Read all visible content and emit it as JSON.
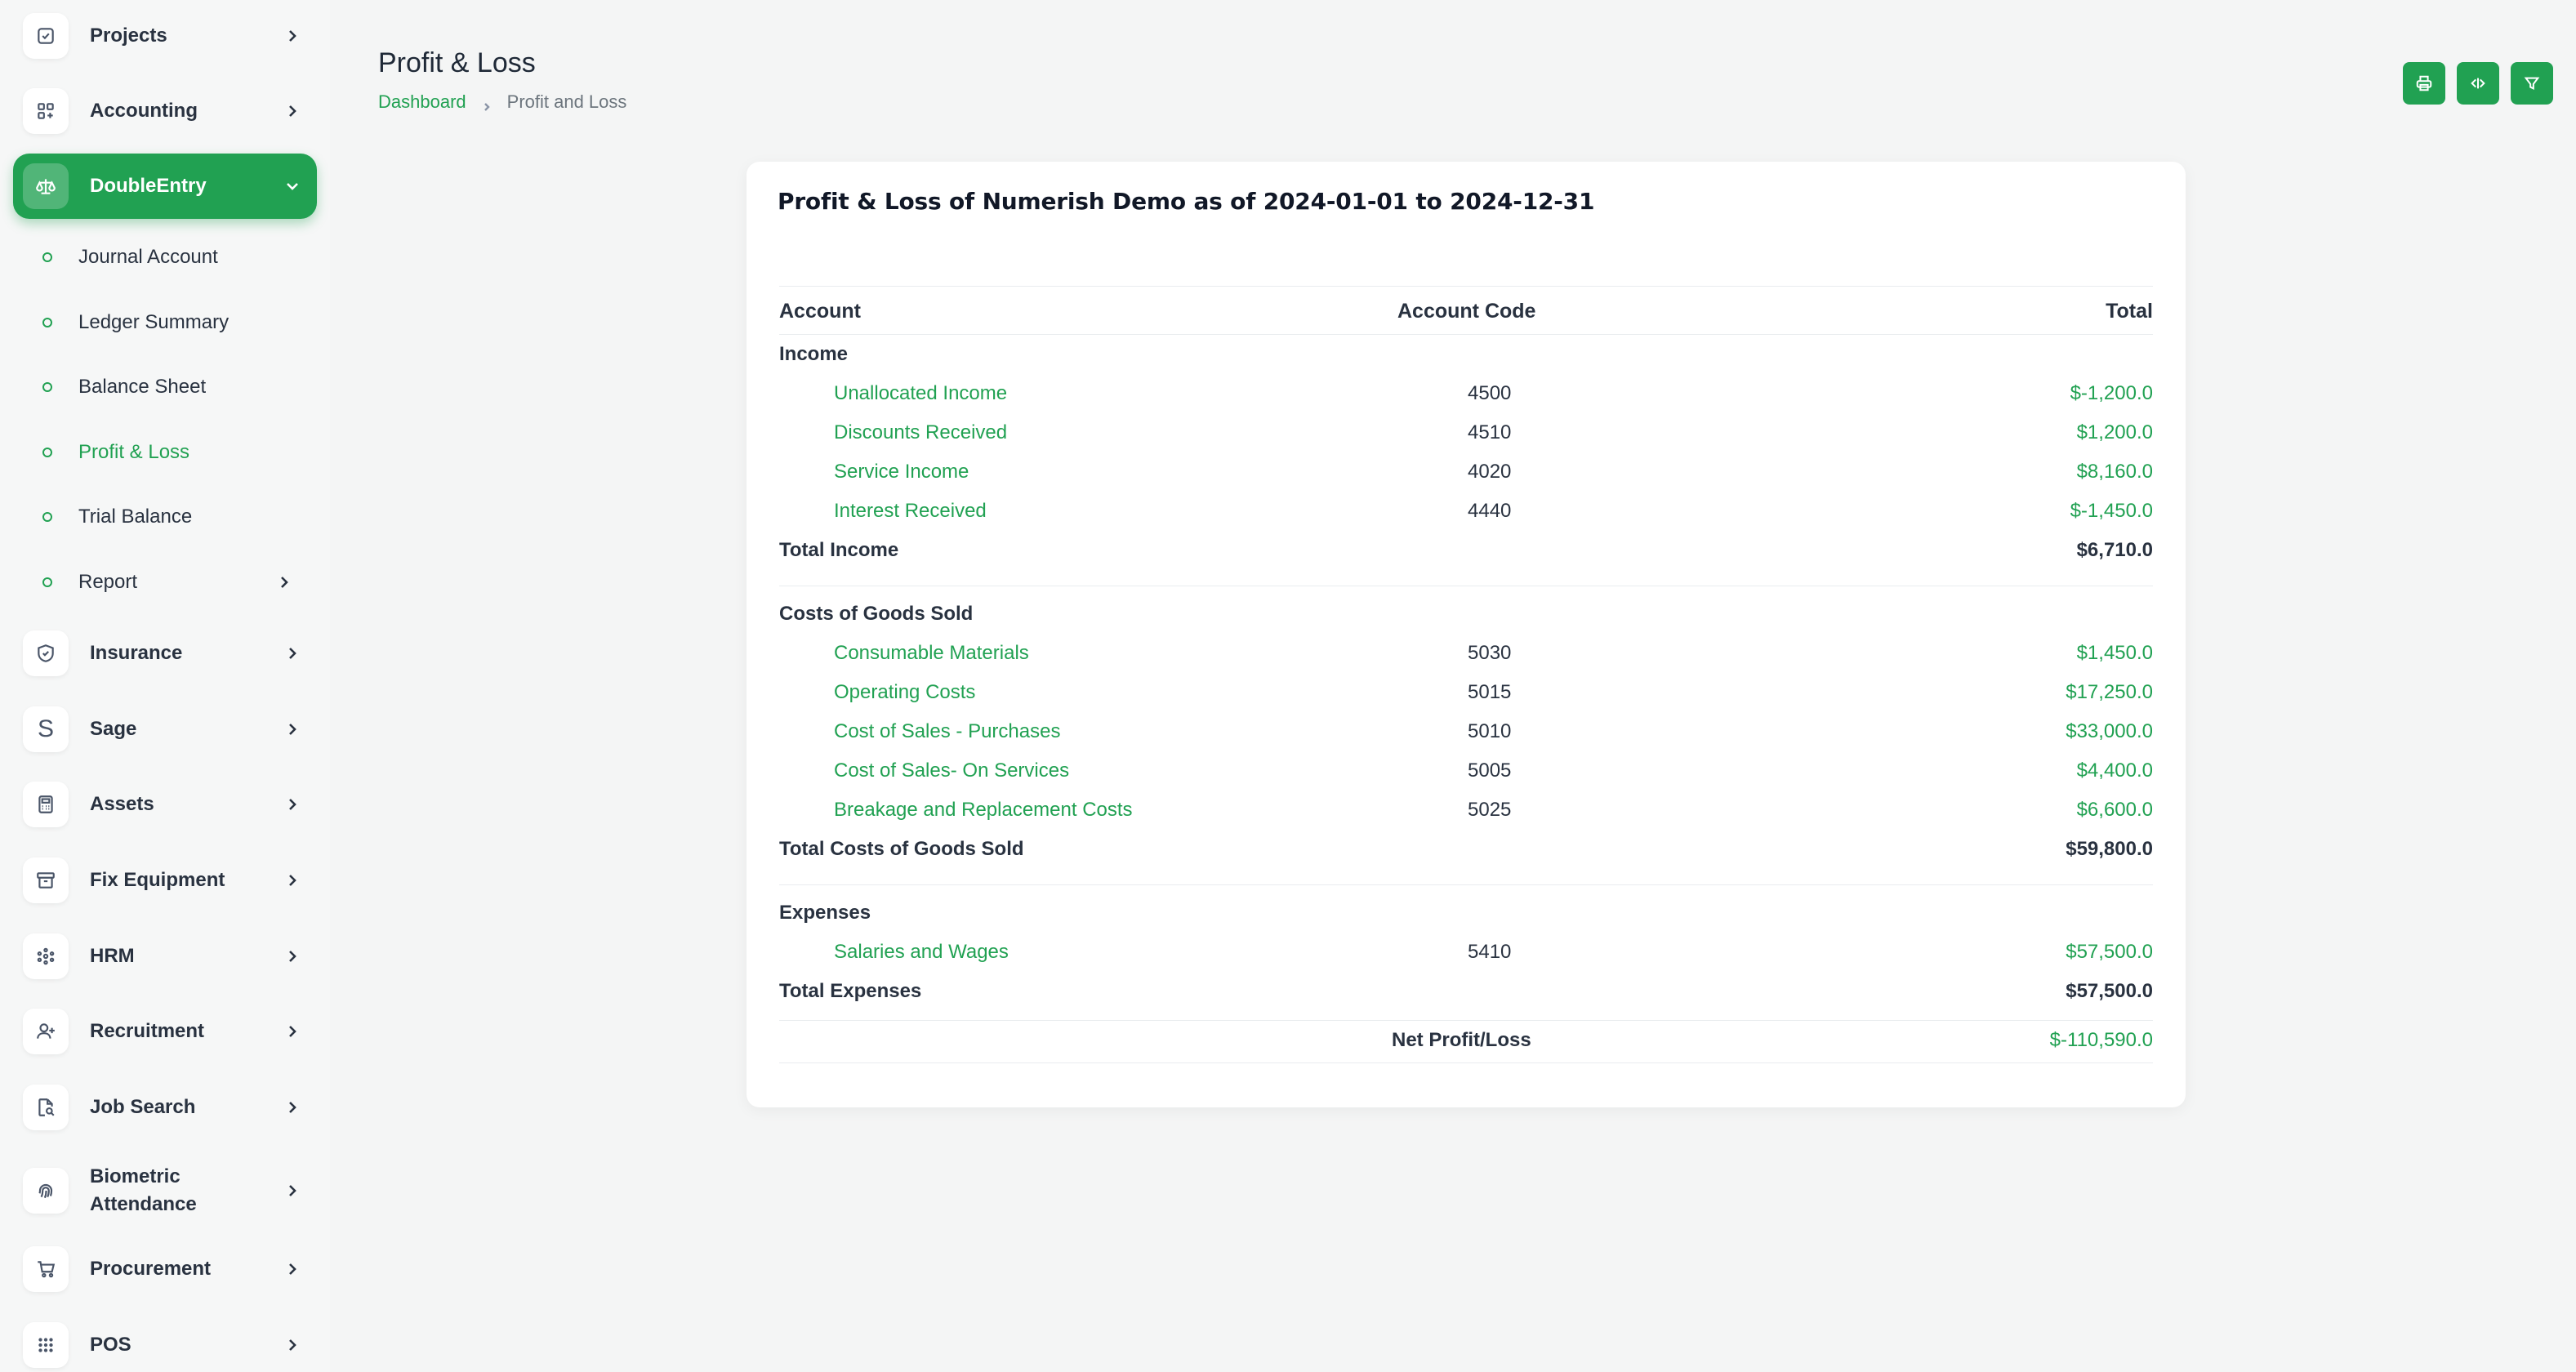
{
  "sidebar": {
    "items": [
      {
        "label": "Projects",
        "icon": "checkbox-icon"
      },
      {
        "label": "Accounting",
        "icon": "grid-plus-icon"
      },
      {
        "label": "DoubleEntry",
        "icon": "scale-icon"
      },
      {
        "label": "Insurance",
        "icon": "shield-icon"
      },
      {
        "label": "Sage",
        "icon": "letter-s-icon",
        "glyph": "S"
      },
      {
        "label": "Assets",
        "icon": "calculator-icon"
      },
      {
        "label": "Fix Equipment",
        "icon": "archive-icon"
      },
      {
        "label": "HRM",
        "icon": "users-circle-icon"
      },
      {
        "label": "Recruitment",
        "icon": "user-plus-icon"
      },
      {
        "label": "Job Search",
        "icon": "file-search-icon"
      },
      {
        "label": "Biometric\nAttendance",
        "label_line1": "Biometric",
        "label_line2": "Attendance",
        "icon": "fingerprint-icon"
      },
      {
        "label": "Procurement",
        "icon": "cart-icon"
      },
      {
        "label": "POS",
        "icon": "dots-grid-icon"
      }
    ],
    "doubleentry_sub": [
      {
        "label": "Journal Account"
      },
      {
        "label": "Ledger Summary"
      },
      {
        "label": "Balance Sheet"
      },
      {
        "label": "Profit & Loss"
      },
      {
        "label": "Trial Balance"
      },
      {
        "label": "Report"
      }
    ]
  },
  "header": {
    "title": "Profit & Loss",
    "breadcrumb": [
      "Dashboard",
      "Profit and Loss"
    ],
    "actions": [
      "print-icon",
      "code-icon",
      "filter-icon"
    ]
  },
  "colors": {
    "accent": "#21a152",
    "text": "#293240"
  },
  "report": {
    "title": "Profit & Loss of Numerish Demo as of 2024-01-01 to 2024-12-31",
    "columns": [
      "Account",
      "Account Code",
      "Total"
    ],
    "sections": [
      {
        "name": "Income",
        "rows": [
          {
            "account": "Unallocated Income",
            "code": "4500",
            "total": "$-1,200.0"
          },
          {
            "account": "Discounts Received",
            "code": "4510",
            "total": "$1,200.0"
          },
          {
            "account": "Service Income",
            "code": "4020",
            "total": "$8,160.0"
          },
          {
            "account": "Interest Received",
            "code": "4440",
            "total": "$-1,450.0"
          }
        ],
        "total_label": "Total Income",
        "total_value": "$6,710.0"
      },
      {
        "name": "Costs of Goods Sold",
        "rows": [
          {
            "account": "Consumable Materials",
            "code": "5030",
            "total": "$1,450.0"
          },
          {
            "account": "Operating Costs",
            "code": "5015",
            "total": "$17,250.0"
          },
          {
            "account": "Cost of Sales - Purchases",
            "code": "5010",
            "total": "$33,000.0"
          },
          {
            "account": "Cost of Sales- On Services",
            "code": "5005",
            "total": "$4,400.0"
          },
          {
            "account": "Breakage and Replacement Costs",
            "code": "5025",
            "total": "$6,600.0"
          }
        ],
        "total_label": "Total Costs of Goods Sold",
        "total_value": "$59,800.0"
      },
      {
        "name": "Expenses",
        "rows": [
          {
            "account": "Salaries and Wages",
            "code": "5410",
            "total": "$57,500.0"
          }
        ],
        "total_label": "Total Expenses",
        "total_value": "$57,500.0"
      }
    ],
    "net_label": "Net Profit/Loss",
    "net_value": "$-110,590.0"
  }
}
